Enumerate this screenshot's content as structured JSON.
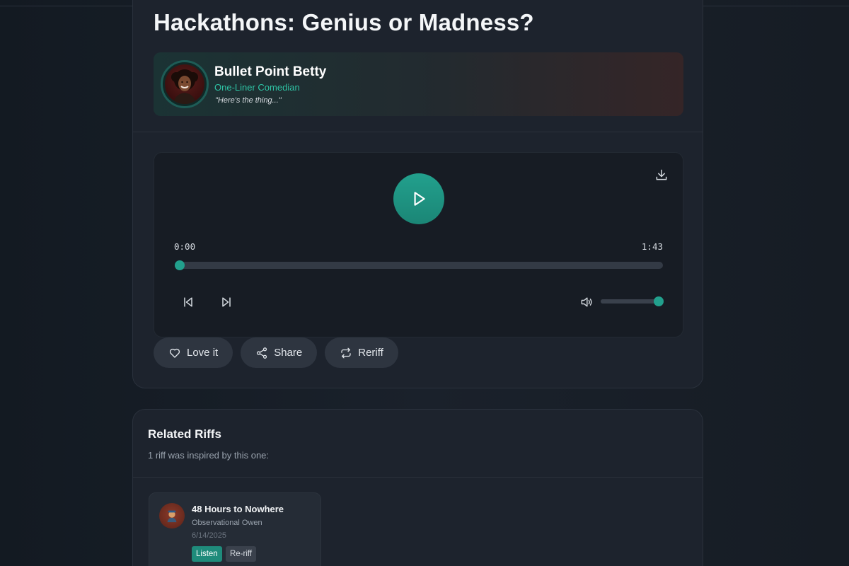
{
  "riff": {
    "title": "Hackathons: Genius or Madness?"
  },
  "comedian": {
    "name": "Bullet Point Betty",
    "role": "One-Liner Comedian",
    "quote": "\"Here's the thing...\""
  },
  "player": {
    "current_time": "0:00",
    "total_time": "1:43",
    "progress": 0,
    "volume": 1.0
  },
  "actions": {
    "love_label": "Love it",
    "share_label": "Share",
    "reriff_label": "Reriff"
  },
  "related": {
    "heading": "Related Riffs",
    "subheading": "1 riff was inspired by this one:",
    "items": [
      {
        "title": "48 Hours to Nowhere",
        "author": "Observational Owen",
        "date": "6/14/2025",
        "listen_label": "Listen",
        "reriff_label": "Re-riff"
      }
    ]
  },
  "colors": {
    "accent": "#22a08d",
    "accent_text": "#2ec4a5",
    "background": "#151b23",
    "card": "#1d232d"
  }
}
